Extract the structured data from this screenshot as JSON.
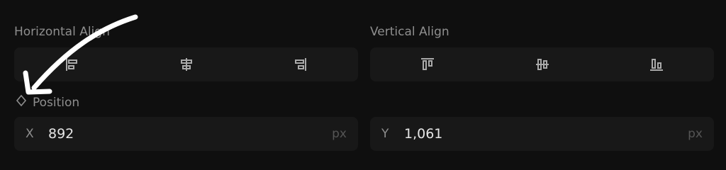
{
  "horizontal_align": {
    "label": "Horizontal Align",
    "options": [
      {
        "icon": "align-left-icon"
      },
      {
        "icon": "align-center-horizontal-icon"
      },
      {
        "icon": "align-right-icon"
      }
    ]
  },
  "vertical_align": {
    "label": "Vertical Align",
    "options": [
      {
        "icon": "align-top-icon"
      },
      {
        "icon": "align-center-vertical-icon"
      },
      {
        "icon": "align-bottom-icon"
      }
    ]
  },
  "position": {
    "label": "Position",
    "keyframe_icon": "diamond-icon",
    "x": {
      "axis": "X",
      "value": "892",
      "unit": "px"
    },
    "y": {
      "axis": "Y",
      "value": "1,061",
      "unit": "px"
    }
  },
  "annotation": {
    "icon": "hand-drawn-arrow-icon"
  },
  "colors": {
    "background": "#0f0f0f",
    "control": "#181818",
    "label": "#8e8e8e",
    "value": "#e6e6e6",
    "unit": "#555555",
    "icon": "#a9a9a9",
    "arrow": "#ffffff"
  }
}
